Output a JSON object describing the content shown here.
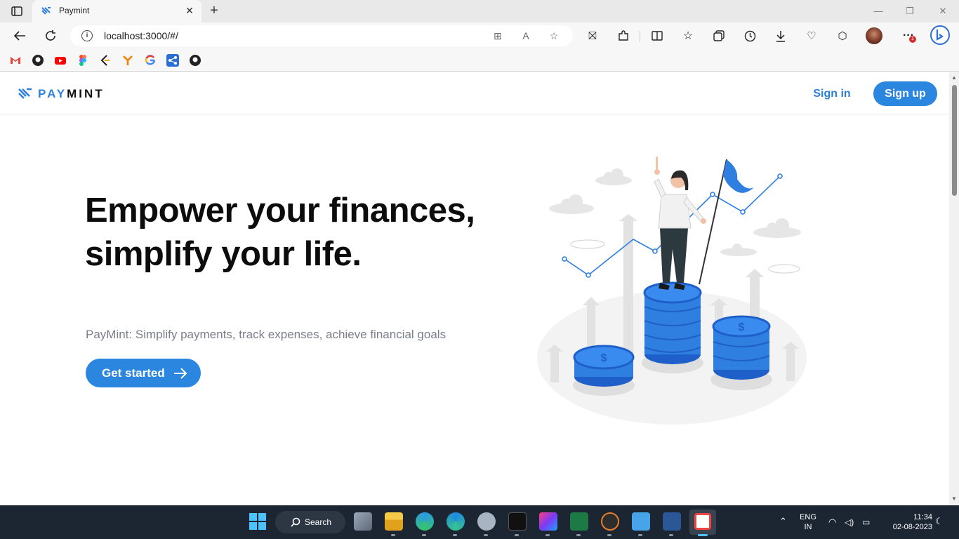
{
  "browser": {
    "tab_title": "Paymint",
    "url": "localhost:3000/#/"
  },
  "site": {
    "logo_pay": "PAY",
    "logo_mint": "MINT",
    "signin_label": "Sign in",
    "signup_label": "Sign up"
  },
  "hero": {
    "title": "Empower your finances, simplify your life.",
    "subtitle": "PayMint: Simplify payments, track expenses, achieve financial goals",
    "cta_label": "Get started"
  },
  "taskbar": {
    "search_label": "Search",
    "lang_line1": "ENG",
    "lang_line2": "IN",
    "time": "11:34",
    "date": "02-08-2023"
  },
  "colors": {
    "brand_blue": "#2b86e0",
    "heading": "#0c0c0c",
    "subtext": "#7a7f88"
  },
  "icons": {
    "toolbar": [
      "back-icon",
      "refresh-icon",
      "info-icon",
      "apps-icon",
      "read-aloud-icon",
      "favorite-star-icon",
      "extension-icon",
      "puzzle-icon",
      "split-screen-icon",
      "favorites-icon",
      "collections-icon",
      "history-icon",
      "download-icon",
      "performance-icon",
      "copilot-shield-icon",
      "profile-avatar",
      "more-icon",
      "bing-icon"
    ],
    "bookmarks": [
      "gmail-icon",
      "github-icon",
      "youtube-icon",
      "figma-icon",
      "codeforces-icon",
      "postman-icon",
      "google-icon",
      "share-icon",
      "github-icon"
    ]
  }
}
